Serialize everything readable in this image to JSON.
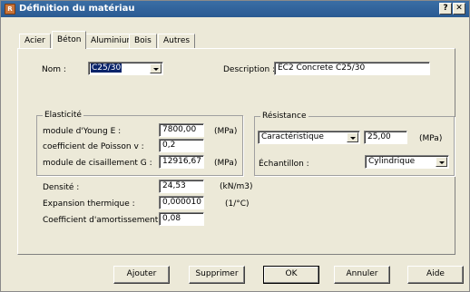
{
  "window": {
    "title": "Définition du matériau",
    "help_label": "?",
    "close_label": "✕"
  },
  "tabs": [
    {
      "label": "Acier"
    },
    {
      "label": "Béton",
      "active": true
    },
    {
      "label": "Aluminium"
    },
    {
      "label": "Bois"
    },
    {
      "label": "Autres"
    }
  ],
  "nom": {
    "label": "Nom :",
    "value": "C25/30"
  },
  "description": {
    "label": "Description :",
    "value": "EC2 Concrete C25/30"
  },
  "elasticite": {
    "title": "Elasticité",
    "young": {
      "label": "module d'Young E :",
      "value": "7800,00",
      "unit": "(MPa)"
    },
    "poisson": {
      "label": "coefficient de Poisson v :",
      "value": "0,2"
    },
    "cisaillement": {
      "label": "module de cisaillement G :",
      "value": "12916,67",
      "unit": "(MPa)"
    }
  },
  "densite": {
    "label": "Densité :",
    "value": "24,53",
    "unit": "(kN/m3)"
  },
  "expansion": {
    "label": "Expansion thermique :",
    "value": "0,000010",
    "unit": "(1/°C)"
  },
  "amortissement": {
    "label": "Coefficient d'amortissement :",
    "value": "0,08"
  },
  "resistance": {
    "title": "Résistance",
    "type": "Caractéristique",
    "value": "25,00",
    "unit": "(MPa)",
    "echantillon_label": "Échantillon :",
    "echantillon_value": "Cylindrique"
  },
  "buttons": {
    "ajouter": "Ajouter",
    "supprimer": "Supprimer",
    "ok": "OK",
    "annuler": "Annuler",
    "aide": "Aide"
  }
}
